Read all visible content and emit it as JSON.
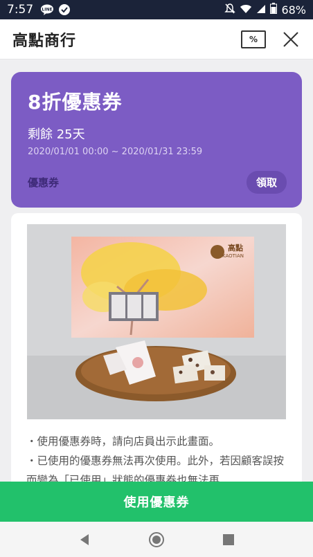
{
  "status_bar": {
    "time": "7:57",
    "battery": "68%"
  },
  "header": {
    "title": "高點商行",
    "coupon_icon_text": "%"
  },
  "coupon": {
    "title": "8折優惠券",
    "remaining_label": "剩餘",
    "remaining_value": "25天",
    "period": "2020/01/01 00:00 ~ 2020/01/31 23:59",
    "label": "優惠券",
    "claim_button": "領取"
  },
  "product_image": {
    "brand_text": "高點",
    "brand_subtext": "KAOTIAN"
  },
  "notice": [
    "・使用優惠券時，請向店員出示此畫面。",
    "・已使用的優惠券無法再次使用。此外，若因顧客誤按而變為「已使用」狀態的優惠券也無法再"
  ],
  "use_button": "使用優惠券"
}
